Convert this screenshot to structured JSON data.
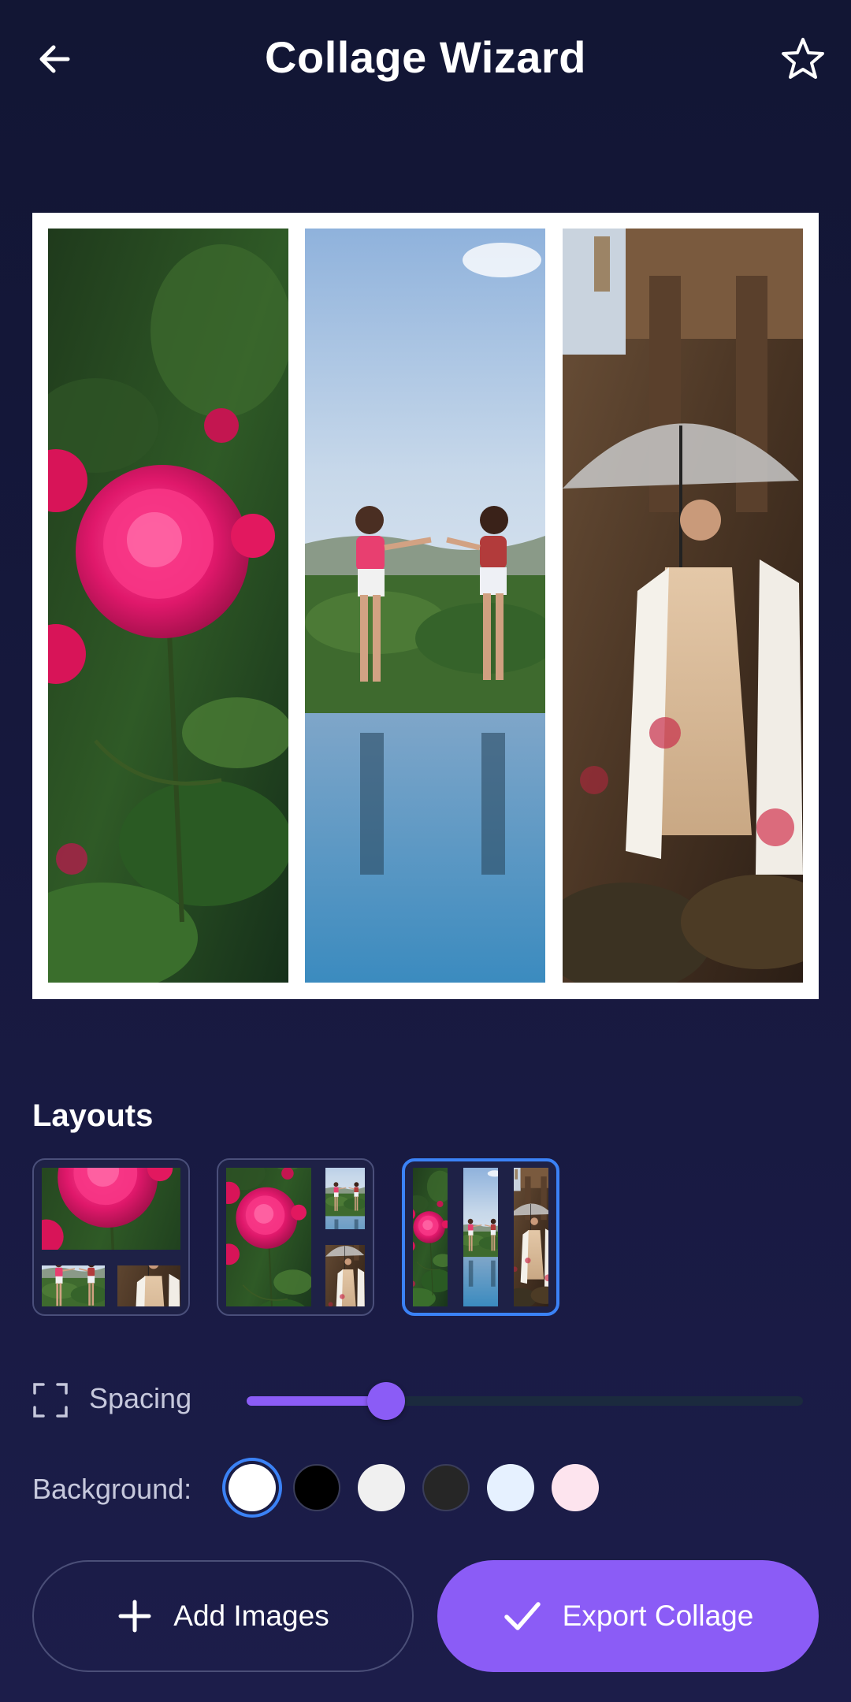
{
  "header": {
    "title": "Collage Wizard",
    "back_icon": "arrow-left-icon",
    "favorite_icon": "star-outline-icon"
  },
  "collage": {
    "panels": [
      "rose-photo",
      "pool-friends-photo",
      "umbrella-woman-photo"
    ],
    "background": "#ffffff"
  },
  "layouts": {
    "title": "Layouts",
    "options": [
      "one-top-two-bottom",
      "one-left-two-right",
      "three-columns"
    ],
    "selected_index": 2
  },
  "spacing": {
    "label": "Spacing",
    "icon": "frame-corners-icon",
    "value": 0.25
  },
  "background": {
    "label": "Background:",
    "swatches": [
      "#ffffff",
      "#000000",
      "#f0f0f0",
      "#262626",
      "#e6f1ff",
      "#fde4ee"
    ],
    "selected_index": 0
  },
  "actions": {
    "add_label": "Add Images",
    "add_icon": "plus-icon",
    "export_label": "Export Collage",
    "export_icon": "check-icon"
  },
  "colors": {
    "accent": "#8b5cf6",
    "selected": "#3b82f6",
    "background": "#16183d"
  }
}
